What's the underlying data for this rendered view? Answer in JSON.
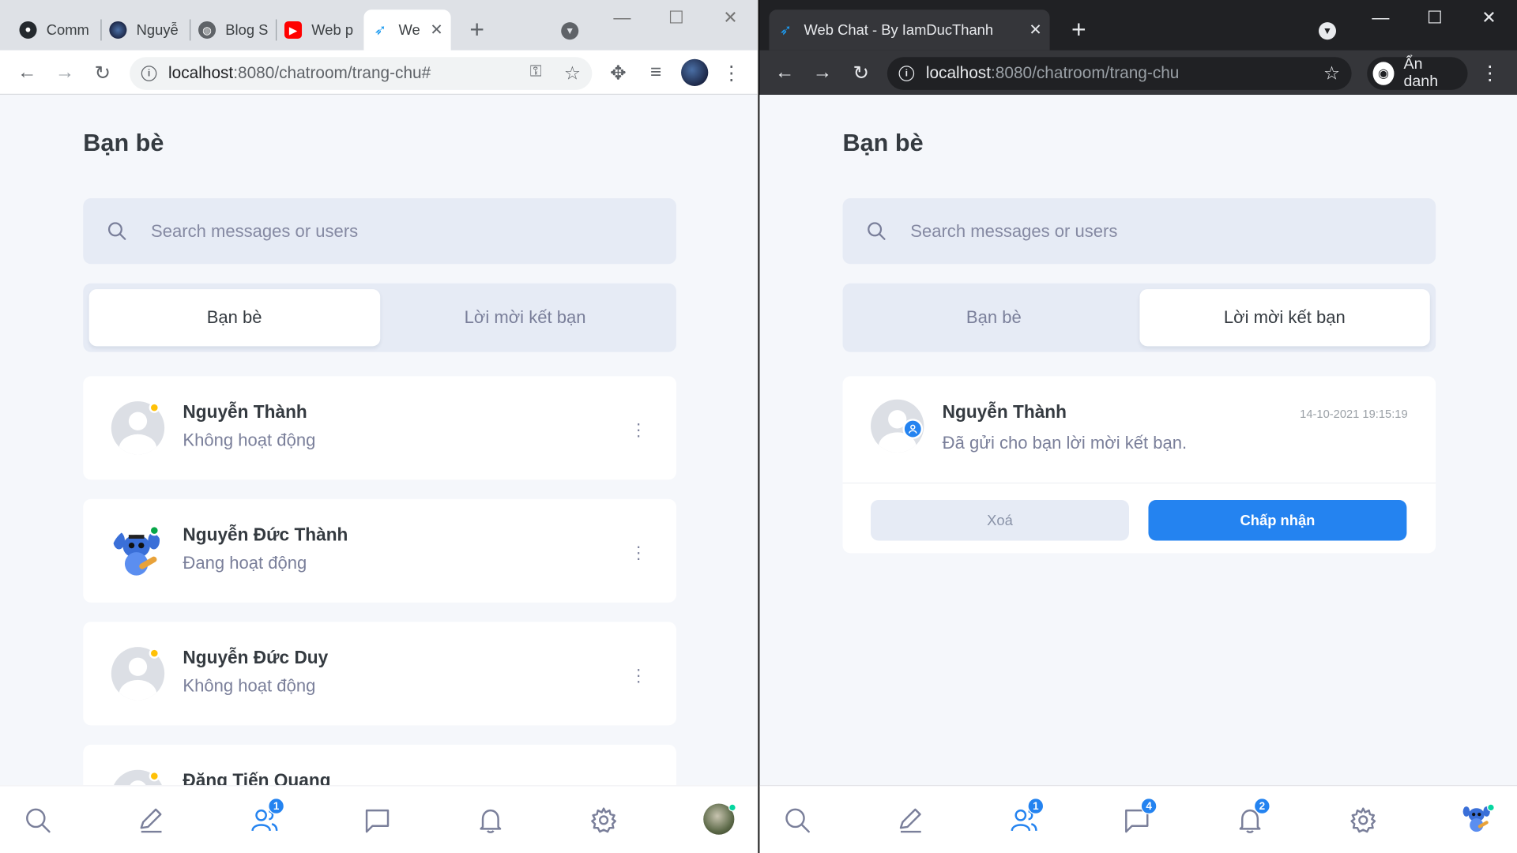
{
  "left_window": {
    "tabs": [
      {
        "title": "Comm",
        "icon": "github-icon"
      },
      {
        "title": "Nguyễ",
        "icon": "avatar-icon"
      },
      {
        "title": "Blog S",
        "icon": "globe-icon"
      },
      {
        "title": "Web p",
        "icon": "youtube-icon"
      },
      {
        "title": "We",
        "icon": "bird-icon",
        "active": true
      }
    ],
    "url_host": "localhost",
    "url_path": ":8080/chatroom/trang-chu#"
  },
  "right_window": {
    "tab_title": "Web Chat - By IamDucThanh",
    "url_host": "localhost",
    "url_path": ":8080/chatroom/trang-chu",
    "incognito_label": "Ẩn danh"
  },
  "app": {
    "page_title": "Bạn bè",
    "search_placeholder": "Search messages or users",
    "segments": [
      "Bạn bè",
      "Lời mời kết bạn"
    ],
    "friends": [
      {
        "name": "Nguyễn Thành",
        "status": "Không hoạt động",
        "online": false
      },
      {
        "name": "Nguyễn Đức Thành",
        "status": "Đang hoạt động",
        "online": true
      },
      {
        "name": "Nguyễn Đức Duy",
        "status": "Không hoạt động",
        "online": false
      },
      {
        "name": "Đặng Tiến Quang",
        "status": "",
        "online": false
      }
    ],
    "request": {
      "name": "Nguyễn Thành",
      "time": "14-10-2021 19:15:19",
      "message": "Đã gửi cho bạn lời mời kết bạn.",
      "delete_label": "Xoá",
      "accept_label": "Chấp nhận"
    },
    "nav_left": {
      "friends_badge": "1"
    },
    "nav_right": {
      "friends_badge": "1",
      "chat_badge": "4",
      "notif_badge": "2"
    }
  },
  "colors": {
    "accent": "#2483f0",
    "offline_dot": "#ffc107",
    "online_dot": "#06a648",
    "page_bg": "#f5f7fb",
    "input_bg": "#e6ebf5"
  }
}
